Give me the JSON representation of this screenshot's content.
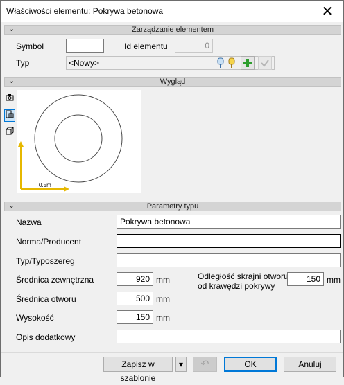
{
  "window": {
    "title": "Właściwości elementu: Pokrywa betonowa",
    "close": "✕"
  },
  "sections": {
    "element": "Zarządzanie elementem",
    "look": "Wygląd",
    "params": "Parametry typu"
  },
  "element": {
    "symbol_label": "Symbol",
    "symbol_value": "",
    "id_label": "Id elementu",
    "id_value": "0",
    "typ_label": "Typ",
    "typ_value": "<Nowy>"
  },
  "preview": {
    "scale_label": "0.5m"
  },
  "params": {
    "nazwa_label": "Nazwa",
    "nazwa_value": "Pokrywa betonowa",
    "norma_label": "Norma/Producent",
    "norma_value": "",
    "typoszereg_label": "Typ/Typoszereg",
    "typoszereg_value": "",
    "srednica_zew_label": "Średnica zewnętrzna",
    "srednica_zew_value": "920",
    "srednica_otw_label": "Średnica otworu",
    "srednica_otw_value": "500",
    "wysokosc_label": "Wysokość",
    "wysokosc_value": "150",
    "odleglosc_label_1": "Odległość skrajni otworu",
    "odleglosc_label_2": "od krawędzi pokrywy",
    "odleglosc_value": "150",
    "opis_label": "Opis dodatkowy",
    "opis_value": "",
    "unit": "mm"
  },
  "buttons": {
    "save_template": "Zapisz w szablonie",
    "dropdown": "▾",
    "undo": "↶",
    "ok": "OK",
    "cancel": "Anuluj"
  },
  "colors": {
    "accent": "#0078d7",
    "section_bg": "#d4d4d4",
    "add_green": "#2e9e2e"
  }
}
